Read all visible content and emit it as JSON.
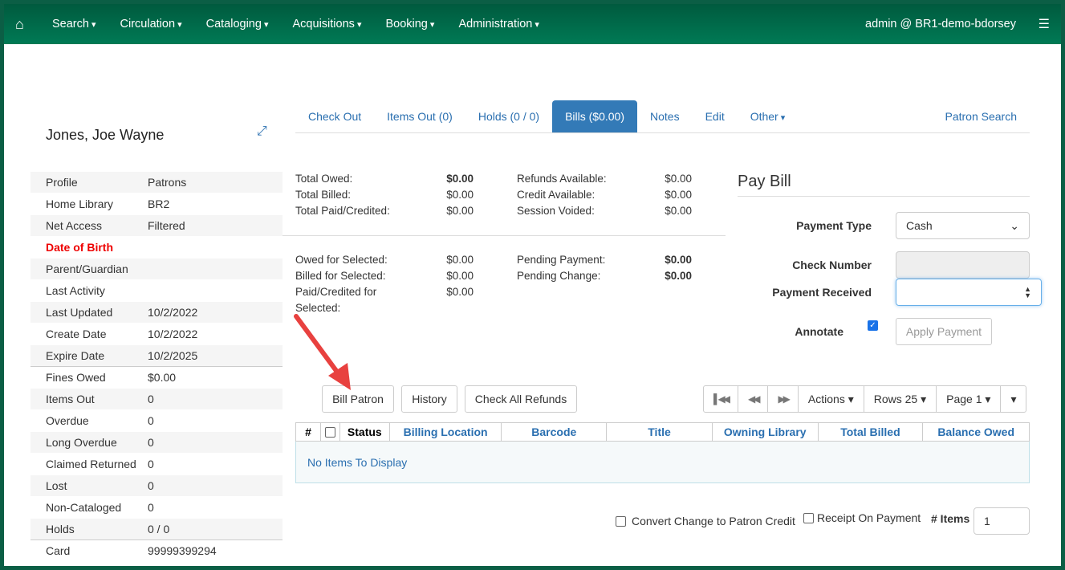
{
  "nav": {
    "home": "home-icon",
    "items": [
      "Search",
      "Circulation",
      "Cataloging",
      "Acquisitions",
      "Booking",
      "Administration"
    ],
    "user": "admin @ BR1-demo-bdorsey"
  },
  "patron": {
    "name": "Jones, Joe Wayne",
    "fields": [
      [
        "Profile",
        "Patrons"
      ],
      [
        "Home Library",
        "BR2"
      ],
      [
        "Net Access",
        "Filtered"
      ],
      [
        "Date of Birth",
        ""
      ],
      [
        "Parent/Guardian",
        ""
      ],
      [
        "Last Activity",
        ""
      ],
      [
        "Last Updated",
        "10/2/2022"
      ],
      [
        "Create Date",
        "10/2/2022"
      ],
      [
        "Expire Date",
        "10/2/2025"
      ],
      [
        "Fines Owed",
        "$0.00"
      ],
      [
        "Items Out",
        "0"
      ],
      [
        "Overdue",
        "0"
      ],
      [
        "Long Overdue",
        "0"
      ],
      [
        "Claimed Returned",
        "0"
      ],
      [
        "Lost",
        "0"
      ],
      [
        "Non-Cataloged",
        "0"
      ],
      [
        "Holds",
        "0 / 0"
      ],
      [
        "Card",
        "99999399294"
      ]
    ]
  },
  "tabs": [
    "Check Out",
    "Items Out (0)",
    "Holds (0 / 0)",
    "Bills ($0.00)",
    "Notes",
    "Edit",
    "Other",
    "Patron Search"
  ],
  "summary": {
    "left1": [
      [
        "Total Owed:",
        "$0.00"
      ],
      [
        "Total Billed:",
        "$0.00"
      ],
      [
        "Total Paid/Credited:",
        "$0.00"
      ]
    ],
    "right1": [
      [
        "Refunds Available:",
        "$0.00"
      ],
      [
        "Credit Available:",
        "$0.00"
      ],
      [
        "Session Voided:",
        "$0.00"
      ]
    ],
    "left2": [
      [
        "Owed for Selected:",
        "$0.00"
      ],
      [
        "Billed for Selected:",
        "$0.00"
      ],
      [
        "Paid/Credited for Selected:",
        "$0.00"
      ]
    ],
    "right2": [
      [
        "Pending Payment:",
        "$0.00"
      ],
      [
        "Pending Change:",
        "$0.00"
      ]
    ]
  },
  "pay": {
    "title": "Pay Bill",
    "payment_type_label": "Payment Type",
    "payment_type": "Cash",
    "check_number_label": "Check Number",
    "payment_received_label": "Payment Received",
    "annotate_label": "Annotate",
    "annotate_checked": true,
    "apply": "Apply Payment"
  },
  "buttons": {
    "bill": "Bill Patron",
    "history": "History",
    "refunds": "Check All Refunds",
    "actions": "Actions",
    "rows": "Rows 25",
    "page": "Page 1"
  },
  "table": {
    "headers": [
      "#",
      "",
      "Status",
      "Billing Location",
      "Barcode",
      "Title",
      "Owning Library",
      "Total Billed",
      "Balance Owed"
    ],
    "empty": "No Items To Display"
  },
  "footer": {
    "convert": "Convert Change to Patron Credit",
    "receipt": "Receipt On Payment",
    "items_label": "# Items",
    "items_value": "1"
  }
}
